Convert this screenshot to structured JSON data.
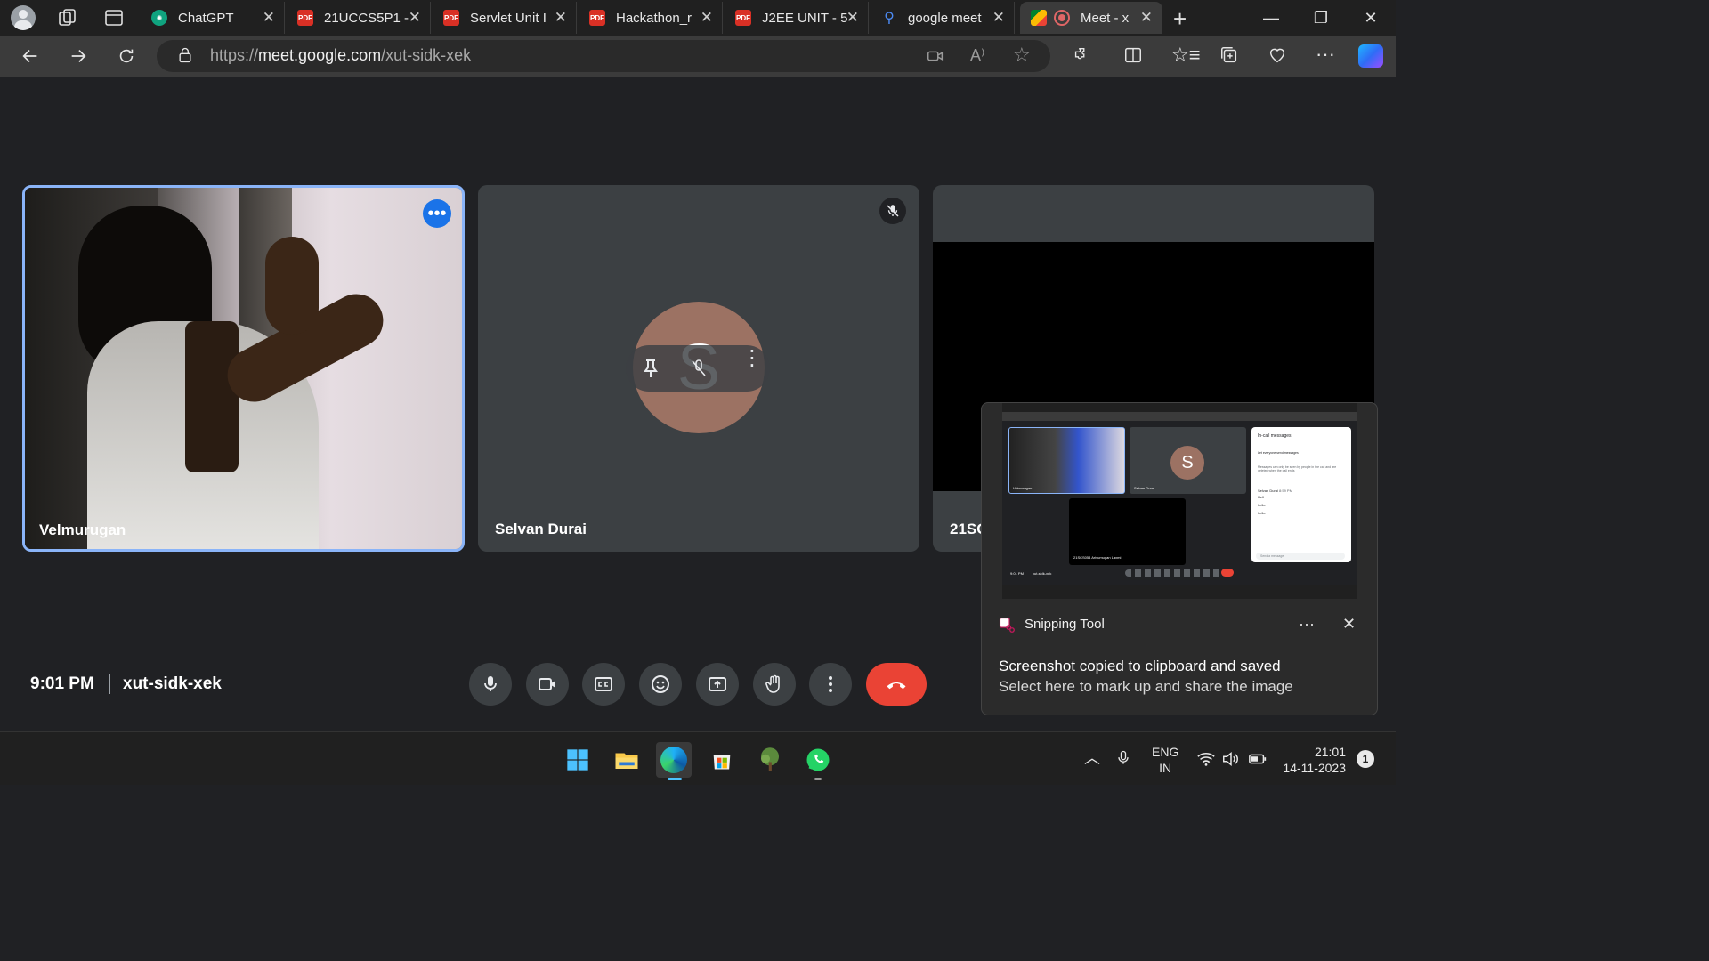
{
  "browser": {
    "tabs": [
      {
        "title": "ChatGPT",
        "icon": "chatgpt-icon"
      },
      {
        "title": "21UCCS5P1 -",
        "icon": "pdf-icon"
      },
      {
        "title": "Servlet Unit I",
        "icon": "pdf-icon"
      },
      {
        "title": "Hackathon_r",
        "icon": "pdf-icon"
      },
      {
        "title": "J2EE UNIT - 5",
        "icon": "pdf-icon"
      },
      {
        "title": "google meet",
        "icon": "search-icon"
      },
      {
        "title": "Meet - x",
        "icon": "meet-icon"
      }
    ],
    "url_prefix": "https://",
    "url_domain": "meet.google.com",
    "url_path": "/xut-sidk-xek"
  },
  "meet": {
    "participants": [
      {
        "name": "Velmurugan"
      },
      {
        "name": "Selvan Durai",
        "initial": "S"
      },
      {
        "name": "21SC"
      }
    ],
    "time": "9:01 PM",
    "meeting_code": "xut-sidk-xek"
  },
  "toast": {
    "app": "Snipping Tool",
    "title": "Screenshot copied to clipboard and saved",
    "subtitle": "Select here to mark up and share the image",
    "thumb": {
      "chat_title": "In-call messages",
      "chat_toggle": "Let everyone send messages",
      "chat_note": "Messages can only be seen by people in the call and are deleted when the call ends",
      "sender": "Selvan Durai",
      "sender_time": "8:59 PM",
      "messages": [
        "Hell",
        "hello",
        "hello"
      ],
      "input_placeholder": "Send a message",
      "tile_name_1": "Velmurugan",
      "tile_name_2": "Selvan Durai",
      "tile_name_3": "21SCS054 Arivumugan Laxmi",
      "time": "9:01 PM",
      "code": "xut-sidk-xek"
    }
  },
  "taskbar": {
    "lang_1": "ENG",
    "lang_2": "IN",
    "clock_time": "21:01",
    "clock_date": "14-11-2023",
    "notification_count": "1"
  },
  "colors": {
    "end_call": "#ea4335",
    "active_tile_border": "#8ab4f8",
    "avatar": "#9c7263"
  }
}
